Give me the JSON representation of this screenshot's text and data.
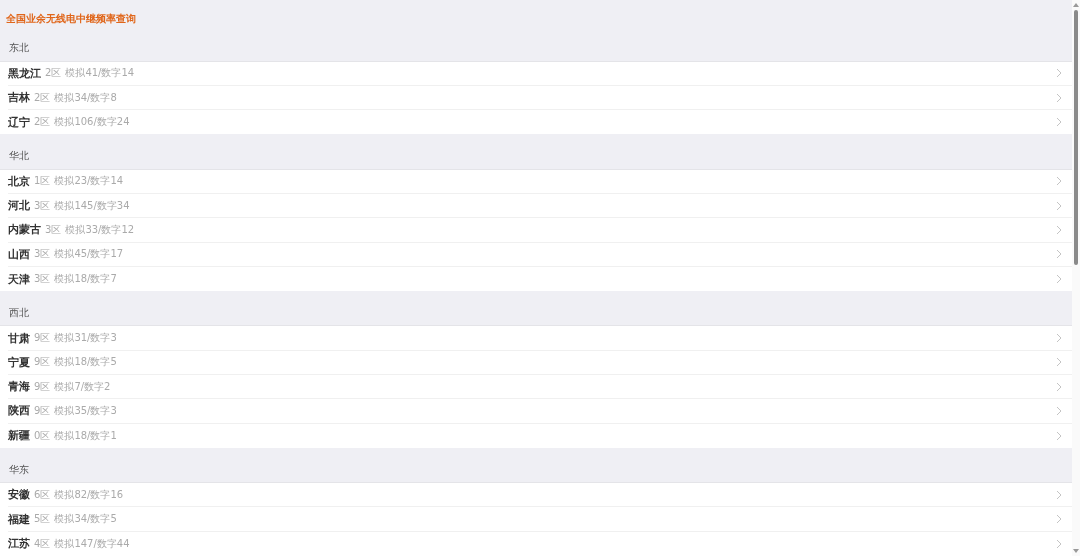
{
  "title": "全国业余无线电中继频率查询",
  "sections": [
    {
      "header": "东北",
      "items": [
        {
          "name": "黑龙江",
          "zone": "2区",
          "counts": "模拟41/数字14"
        },
        {
          "name": "吉林",
          "zone": "2区",
          "counts": "模拟34/数字8"
        },
        {
          "name": "辽宁",
          "zone": "2区",
          "counts": "模拟106/数字24"
        }
      ]
    },
    {
      "header": "华北",
      "items": [
        {
          "name": "北京",
          "zone": "1区",
          "counts": "模拟23/数字14"
        },
        {
          "name": "河北",
          "zone": "3区",
          "counts": "模拟145/数字34"
        },
        {
          "name": "内蒙古",
          "zone": "3区",
          "counts": "模拟33/数字12"
        },
        {
          "name": "山西",
          "zone": "3区",
          "counts": "模拟45/数字17"
        },
        {
          "name": "天津",
          "zone": "3区",
          "counts": "模拟18/数字7"
        }
      ]
    },
    {
      "header": "西北",
      "items": [
        {
          "name": "甘肃",
          "zone": "9区",
          "counts": "模拟31/数字3"
        },
        {
          "name": "宁夏",
          "zone": "9区",
          "counts": "模拟18/数字5"
        },
        {
          "name": "青海",
          "zone": "9区",
          "counts": "模拟7/数字2"
        },
        {
          "name": "陕西",
          "zone": "9区",
          "counts": "模拟35/数字3"
        },
        {
          "name": "新疆",
          "zone": "0区",
          "counts": "模拟18/数字1"
        }
      ]
    },
    {
      "header": "华东",
      "items": [
        {
          "name": "安徽",
          "zone": "6区",
          "counts": "模拟82/数字16"
        },
        {
          "name": "福建",
          "zone": "5区",
          "counts": "模拟34/数字5"
        },
        {
          "name": "江苏",
          "zone": "4区",
          "counts": "模拟147/数字44"
        }
      ]
    }
  ]
}
